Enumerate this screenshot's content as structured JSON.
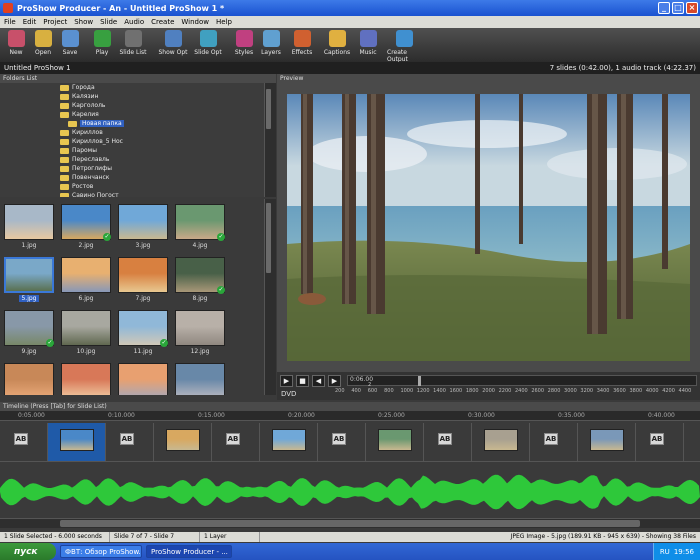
{
  "window": {
    "title": "ProShow Producer - An - Untitled ProShow 1 *"
  },
  "menu": [
    "File",
    "Edit",
    "Project",
    "Show",
    "Slide",
    "Audio",
    "Create",
    "Window",
    "Help"
  ],
  "toolbar": [
    {
      "label": "New",
      "color": "#c8506a"
    },
    {
      "label": "Open",
      "color": "#d8b040"
    },
    {
      "label": "Save",
      "color": "#5a90d0"
    },
    {
      "label": "Play",
      "color": "#38a040"
    },
    {
      "label": "Slide List",
      "color": "#707070"
    },
    {
      "label": "Show Opt",
      "color": "#5080c0"
    },
    {
      "label": "Slide Opt",
      "color": "#40a0c0"
    },
    {
      "label": "Styles",
      "color": "#c04080"
    },
    {
      "label": "Layers",
      "color": "#60a0d0"
    },
    {
      "label": "Effects",
      "color": "#d06030"
    },
    {
      "label": "Captions",
      "color": "#e0b040"
    },
    {
      "label": "Music",
      "color": "#6070c0"
    },
    {
      "label": "Create Output",
      "color": "#4090d0"
    }
  ],
  "project": {
    "name": "Untitled ProShow 1",
    "summary": "7 slides (0:42.00), 1 audio track (4:22.37)"
  },
  "folders_panel": {
    "title": "Folders List",
    "items": [
      {
        "label": "Города",
        "selected": false
      },
      {
        "label": "Калязин",
        "selected": false
      },
      {
        "label": "Каргололь",
        "selected": false
      },
      {
        "label": "Карелия",
        "selected": false
      },
      {
        "label": "Новая папка",
        "selected": true
      },
      {
        "label": "Кириллов",
        "selected": false
      },
      {
        "label": "Кириллов_5 Нос",
        "selected": false
      },
      {
        "label": "Паромы",
        "selected": false
      },
      {
        "label": "Переславль",
        "selected": false
      },
      {
        "label": "Петроглифы",
        "selected": false
      },
      {
        "label": "Повенчанск",
        "selected": false
      },
      {
        "label": "Ростов",
        "selected": false
      },
      {
        "label": "Савино Погост",
        "selected": false
      }
    ]
  },
  "files": [
    {
      "name": "1.jpg",
      "used": false,
      "selected": false,
      "palette": "#a8b8c8,#e8c8a0"
    },
    {
      "name": "2.jpg",
      "used": true,
      "selected": false,
      "palette": "#4a88c8,#d8a860"
    },
    {
      "name": "3.jpg",
      "used": false,
      "selected": false,
      "palette": "#70a8d8,#c8b890"
    },
    {
      "name": "4.jpg",
      "used": true,
      "selected": false,
      "palette": "#6a9870,#c8a888"
    },
    {
      "name": "5.jpg",
      "used": false,
      "selected": true,
      "palette": "#7aa8c8,#5a7050"
    },
    {
      "name": "6.jpg",
      "used": false,
      "selected": false,
      "palette": "#e8b070,#8898b8"
    },
    {
      "name": "7.jpg",
      "used": false,
      "selected": false,
      "palette": "#d88040,#e8c890"
    },
    {
      "name": "8.jpg",
      "used": true,
      "selected": false,
      "palette": "#486048,#a89878"
    },
    {
      "name": "9.jpg",
      "used": true,
      "selected": false,
      "palette": "#8898a8,#788868"
    },
    {
      "name": "10.jpg",
      "used": false,
      "selected": false,
      "palette": "#a8a8a0,#606850"
    },
    {
      "name": "11.jpg",
      "used": true,
      "selected": false,
      "palette": "#90b8d8,#d0c8b8"
    },
    {
      "name": "12.jpg",
      "used": false,
      "selected": false,
      "palette": "#b8b0a8,#908880"
    },
    {
      "name": "",
      "used": false,
      "selected": false,
      "palette": "#c88858,#e8a878"
    },
    {
      "name": "",
      "used": false,
      "selected": false,
      "palette": "#d87858,#f0c8a0"
    },
    {
      "name": "",
      "used": false,
      "selected": false,
      "palette": "#e8a070,#a8a8b8"
    },
    {
      "name": "",
      "used": false,
      "selected": false,
      "palette": "#6888a8,#b8b8c0"
    }
  ],
  "preview": {
    "title": "Preview",
    "time": "0:06.00",
    "slide_no": "2",
    "format": "DVD"
  },
  "ruler": [
    "200",
    "400",
    "600",
    "800",
    "1000",
    "1200",
    "1400",
    "1600",
    "1800",
    "2000",
    "2200",
    "2400",
    "2600",
    "2800",
    "3000",
    "3200",
    "3400",
    "3600",
    "3800",
    "4000",
    "4200",
    "4400"
  ],
  "timeline": {
    "title": "Timeline (Press [Tab] for Slide List)",
    "times": [
      "0:05.000",
      "0:10.000",
      "0:15.000",
      "0:20.000",
      "0:25.000",
      "0:30.000",
      "0:35.000",
      "0:40.000"
    ]
  },
  "status": {
    "selection": "1 Slide Selected - 6.000 seconds",
    "slide": "Slide 7 of 7 - Slide 7",
    "layers": "1 Layer",
    "image": "JPEG Image - 5.jpg (189.91 KB - 945 x 639) - Showing 38 Files"
  },
  "taskbar": {
    "start": "пуск",
    "tasks": [
      "ФВТ: Обзор ProShow...",
      "ProShow Producer - ..."
    ],
    "lang": "RU",
    "clock": "19:56"
  }
}
